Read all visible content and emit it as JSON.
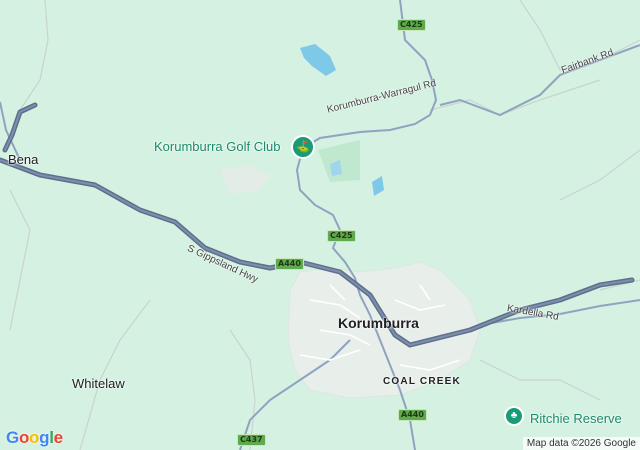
{
  "map": {
    "places": {
      "town_main": "Korumburra",
      "suburb": "COAL CREEK",
      "bena": "Bena",
      "whitelaw": "Whitelaw"
    },
    "pois": {
      "golf": "Korumburra Golf Club",
      "reserve": "Ritchie Reserve"
    },
    "roads": {
      "warragul": "Korumburra-Warragul Rd",
      "fairbank": "Fairbank Rd",
      "kardella": "Kardella Rd",
      "gippsland": "S Gippsland Hwy"
    },
    "shields": {
      "c425_top": "C425",
      "c425_mid": "C425",
      "a440_mid": "A440",
      "a440_bottom": "A440",
      "c437": "C437"
    },
    "colors": {
      "land": "#d4f1e2",
      "highway": "#5c6f8c",
      "road": "#8fa3c0",
      "water": "#7ec8e8",
      "urban": "#e9efea",
      "poi": "#1a9b78"
    }
  },
  "branding": {
    "logo_letters": [
      "G",
      "o",
      "o",
      "g",
      "l",
      "e"
    ],
    "logo_colors": [
      "#4285F4",
      "#EA4335",
      "#FBBC05",
      "#4285F4",
      "#34A853",
      "#EA4335"
    ],
    "attribution": "Map data ©2026 Google"
  }
}
